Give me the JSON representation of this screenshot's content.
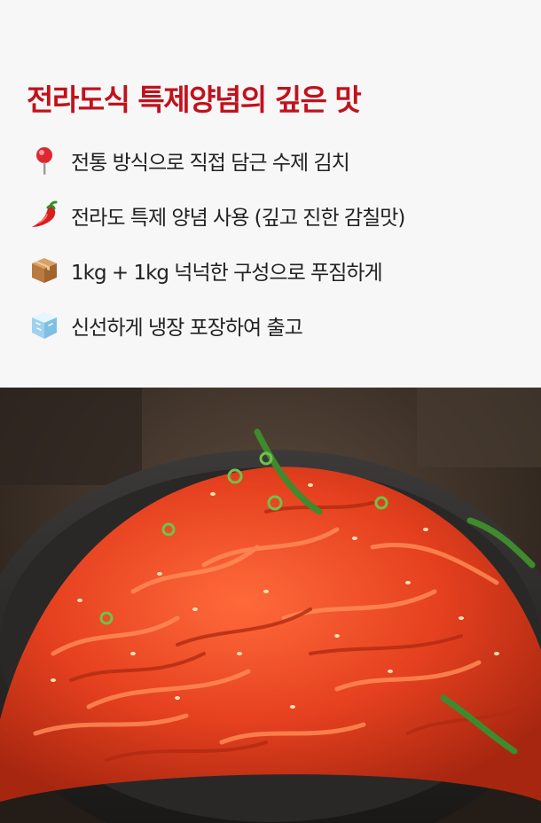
{
  "headline": "전라도식 특제양념의 깊은 맛",
  "features": [
    {
      "icon": "pin-icon",
      "text": "전통 방식으로 직접 담근 수제 김치"
    },
    {
      "icon": "chili-pepper-icon",
      "text": "전라도 특제 양념 사용 (깊고 진한 감칠맛)"
    },
    {
      "icon": "package-box-icon",
      "text": "1kg + 1kg 넉넉한 구성으로 푸짐하게"
    },
    {
      "icon": "ice-cube-icon",
      "text": "신선하게 냉장 포장하여 출고"
    }
  ],
  "colors": {
    "headline": "#c1121c",
    "background": "#f7f7f7",
    "text": "#222222"
  }
}
